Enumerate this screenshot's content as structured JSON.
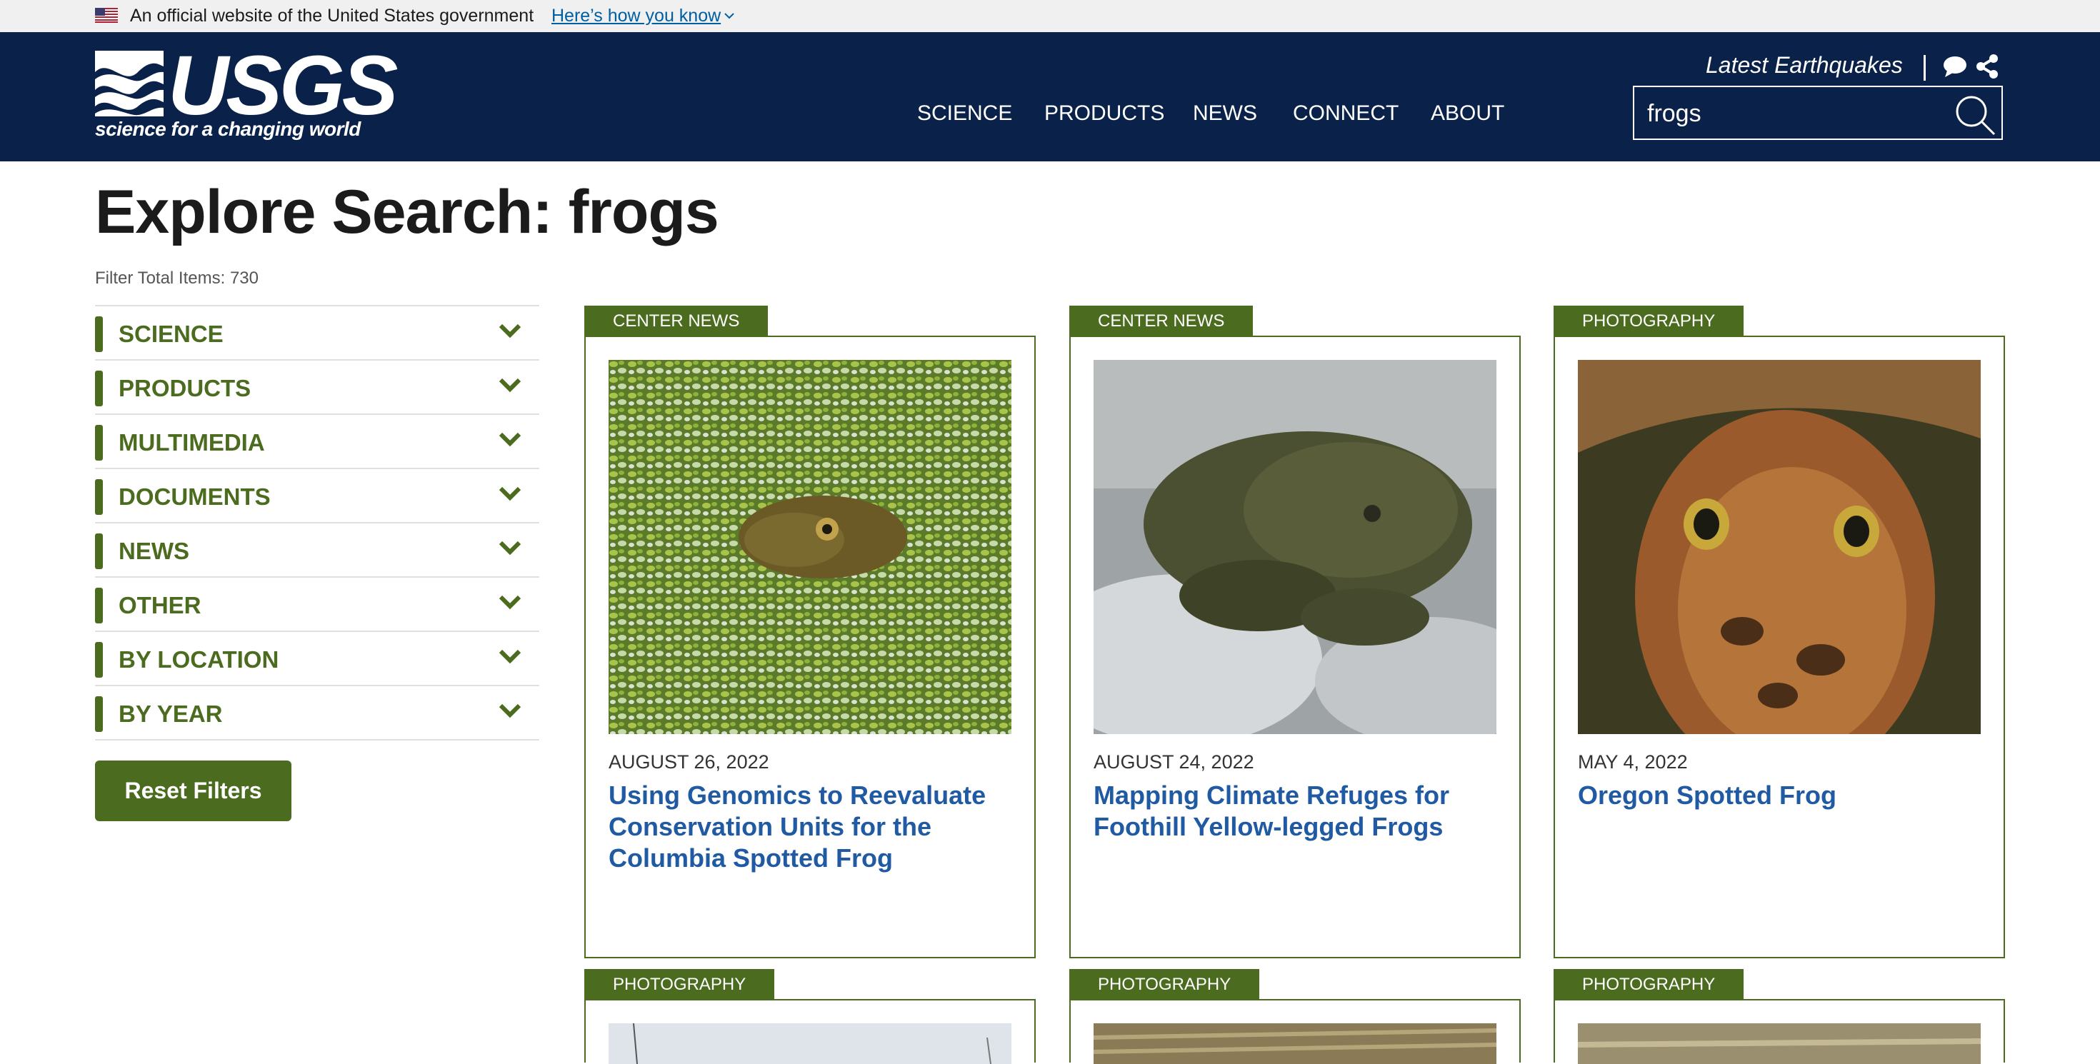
{
  "gov_banner": {
    "text": "An official website of the United States government",
    "link": "Here’s how you know"
  },
  "header": {
    "logo_word": "USGS",
    "logo_tagline": "science for a changing world",
    "nav": [
      "SCIENCE",
      "PRODUCTS",
      "NEWS",
      "CONNECT",
      "ABOUT"
    ],
    "latest_link": "Latest Earthquakes",
    "search_value": "frogs",
    "colors": {
      "background": "#0a2249",
      "text": "#ffffff"
    }
  },
  "page": {
    "title": "Explore Search: frogs",
    "total": "Filter Total Items: 730"
  },
  "filters": [
    "SCIENCE",
    "PRODUCTS",
    "MULTIMEDIA",
    "DOCUMENTS",
    "NEWS",
    "OTHER",
    "BY LOCATION",
    "BY YEAR"
  ],
  "reset_label": "Reset Filters",
  "accent_color": "#4b6b1e",
  "link_color": "#1f5aa3",
  "cards": [
    {
      "tag": "CENTER NEWS",
      "date": "AUGUST 26, 2022",
      "title": "Using Genomics to Reevaluate Conservation Units for the Columbia Spotted Frog",
      "image": "frog-in-duckweed"
    },
    {
      "tag": "CENTER NEWS",
      "date": "AUGUST 24, 2022",
      "title": "Mapping Climate Refuges for Foothill Yellow-legged Frogs",
      "image": "frog-on-rock"
    },
    {
      "tag": "PHOTOGRAPHY",
      "date": "MAY 4, 2022",
      "title": "Oregon Spotted Frog",
      "image": "frog-top-view"
    },
    {
      "tag": "PHOTOGRAPHY",
      "image": "wetland-sky"
    },
    {
      "tag": "PHOTOGRAPHY",
      "image": "dry-grass"
    },
    {
      "tag": "PHOTOGRAPHY",
      "image": "grass-ground"
    }
  ]
}
